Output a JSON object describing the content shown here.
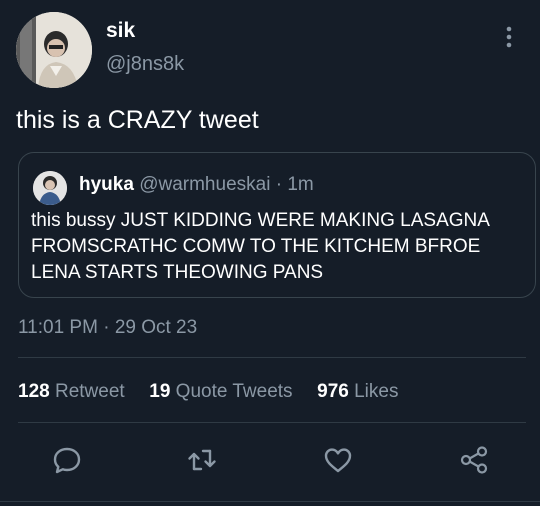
{
  "author": {
    "display_name": "sik",
    "handle": "@j8ns8k"
  },
  "tweet": {
    "text": "this is a CRAZY tweet"
  },
  "quoted_tweet": {
    "display_name": "hyuka",
    "handle": "@warmhueskai",
    "separator": "·",
    "age": "1m",
    "text": "this bussy JUST KIDDING WERE MAKING LASAGNA FROMSCRATHC COMW TO THE KITCHEM BFROE LENA STARTS THEOWING PANS"
  },
  "meta": {
    "time": "11:01 PM",
    "separator": "·",
    "date": "29 Oct 23"
  },
  "stats": {
    "retweets": {
      "count": "128",
      "label": "Retweet"
    },
    "quotes": {
      "count": "19",
      "label": "Quote Tweets"
    },
    "likes": {
      "count": "976",
      "label": "Likes"
    }
  },
  "icons": {
    "reply": "speech-bubble-icon",
    "retweet": "retweet-arrows-icon",
    "like": "heart-icon",
    "share": "share-nodes-icon",
    "more": "vertical-dots-icon"
  },
  "colors": {
    "background": "#151d28",
    "muted": "#8b98a5",
    "border": "#38444d"
  }
}
